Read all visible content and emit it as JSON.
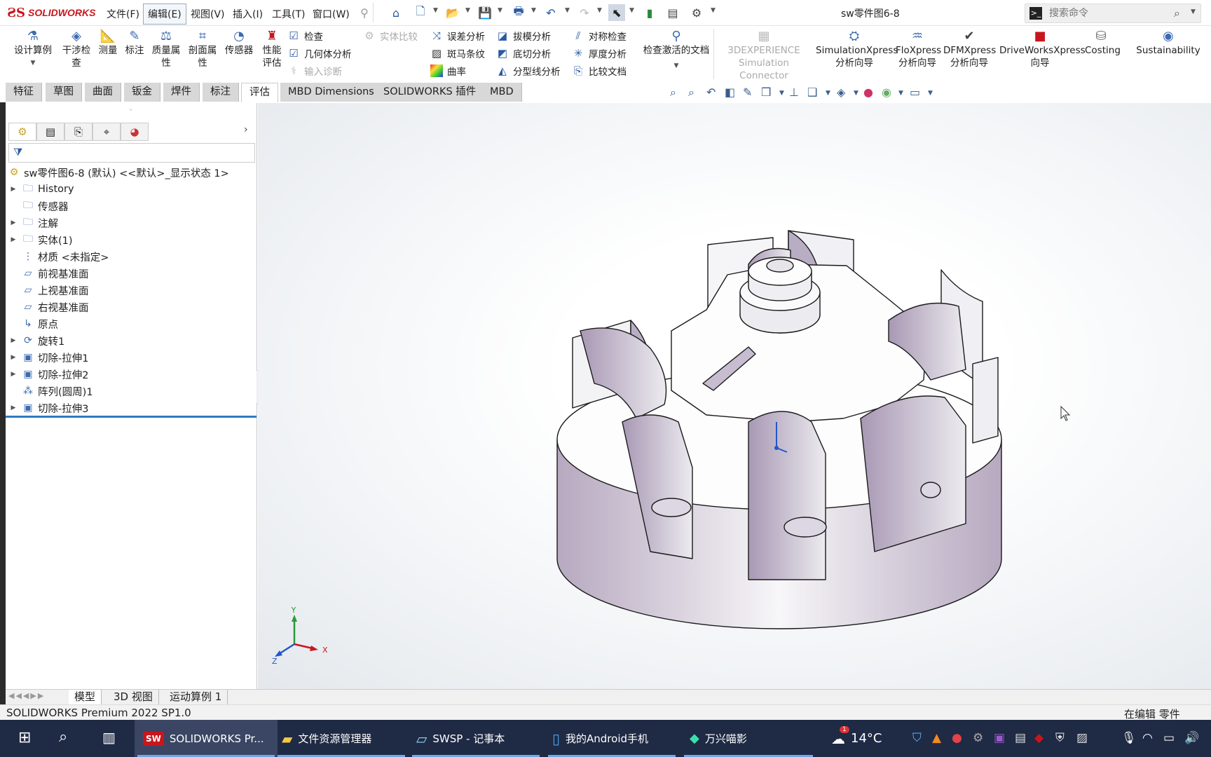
{
  "app": {
    "logo_mark": "ƧS",
    "logo_text": "SOLIDWORKS",
    "doc_title": "sw零件图6-8"
  },
  "menus": [
    "文件(F)",
    "编辑(E)",
    "视图(V)",
    "插入(I)",
    "工具(T)",
    "窗口(W)"
  ],
  "search": {
    "placeholder": "搜索命令"
  },
  "ribbon": {
    "big": [
      {
        "label1": "设计算例",
        "label2": "",
        "icon": "design-study-icon"
      },
      {
        "label1": "干涉检",
        "label2": "查",
        "icon": "interference-icon"
      },
      {
        "label1": "测量",
        "label2": "",
        "icon": "measure-icon"
      },
      {
        "label1": "标注",
        "label2": "",
        "icon": "markup-icon"
      },
      {
        "label1": "质量属",
        "label2": "性",
        "icon": "mass-props-icon"
      },
      {
        "label1": "剖面属",
        "label2": "性",
        "icon": "section-props-icon"
      },
      {
        "label1": "传感器",
        "label2": "",
        "icon": "sensor-icon"
      },
      {
        "label1": "性能",
        "label2": "评估",
        "icon": "performance-icon"
      }
    ],
    "small_col1": [
      "检查",
      "几何体分析",
      "输入诊断"
    ],
    "small_col1b": [
      "实体比较"
    ],
    "small_col2": [
      "误差分析",
      "斑马条纹",
      "曲率"
    ],
    "small_col3": [
      "拔模分析",
      "底切分析",
      "分型线分析"
    ],
    "small_col4": [
      "对称检查",
      "厚度分析",
      "比较文档"
    ],
    "check_active": "检查激活的文档",
    "connector1": "3DEXPERIENCE",
    "connector2": "Simulation Connector",
    "xpress": [
      {
        "l1": "SimulationXpress",
        "l2": "分析向导"
      },
      {
        "l1": "FloXpress",
        "l2": "分析向导"
      },
      {
        "l1": "DFMXpress",
        "l2": "分析向导"
      },
      {
        "l1": "DriveWorksXpress",
        "l2": "向导"
      },
      {
        "l1": "Costing",
        "l2": ""
      },
      {
        "l1": "Sustainability",
        "l2": ""
      }
    ]
  },
  "tabs": [
    "特征",
    "草图",
    "曲面",
    "钣金",
    "焊件",
    "标注",
    "评估",
    "MBD Dimensions",
    "SOLIDWORKS 插件",
    "MBD"
  ],
  "active_tab": "评估",
  "tree": {
    "root": "sw零件图6-8 (默认) <<默认>_显示状态 1>",
    "items": [
      {
        "label": "History",
        "expandable": true,
        "icon": "history-folder-icon"
      },
      {
        "label": "传感器",
        "expandable": false,
        "icon": "sensors-folder-icon"
      },
      {
        "label": "注解",
        "expandable": true,
        "icon": "annotations-folder-icon"
      },
      {
        "label": "实体(1)",
        "expandable": true,
        "icon": "solid-bodies-folder-icon"
      },
      {
        "label": "材质 <未指定>",
        "expandable": false,
        "icon": "material-icon"
      },
      {
        "label": "前视基准面",
        "expandable": false,
        "icon": "plane-icon"
      },
      {
        "label": "上视基准面",
        "expandable": false,
        "icon": "plane-icon"
      },
      {
        "label": "右视基准面",
        "expandable": false,
        "icon": "plane-icon"
      },
      {
        "label": "原点",
        "expandable": false,
        "icon": "origin-icon"
      },
      {
        "label": "旋转1",
        "expandable": true,
        "icon": "revolve-icon"
      },
      {
        "label": "切除-拉伸1",
        "expandable": true,
        "icon": "cut-extrude-icon"
      },
      {
        "label": "切除-拉伸2",
        "expandable": true,
        "icon": "cut-extrude-icon"
      },
      {
        "label": "阵列(圆周)1",
        "expandable": false,
        "icon": "circular-pattern-icon"
      },
      {
        "label": "切除-拉伸3",
        "expandable": true,
        "icon": "cut-extrude-icon"
      }
    ]
  },
  "bottom_tabs": [
    "模型",
    "3D 视图",
    "运动算例 1"
  ],
  "status": {
    "left": "SOLIDWORKS Premium 2022 SP1.0",
    "right": "在编辑 零件"
  },
  "triad": {
    "x": "X",
    "y": "Y",
    "z": "Z"
  },
  "taskbar": {
    "items": [
      {
        "label": "SOLIDWORKS Pr...",
        "icon": "solidworks-app-icon",
        "active": true
      },
      {
        "label": "文件资源管理器",
        "icon": "file-explorer-icon",
        "active": false
      },
      {
        "label": "SWSP - 记事本",
        "icon": "notepad-icon",
        "active": false
      },
      {
        "label": "我的Android手机",
        "icon": "phone-link-icon",
        "active": false
      },
      {
        "label": "万兴喵影",
        "icon": "filmora-icon",
        "active": false
      }
    ],
    "weather_temp": "14°C",
    "weather_badge": "1"
  },
  "colors": {
    "brand": "#c8161d",
    "accent": "#2d7cc1",
    "taskbar": "#1f2a44",
    "part_shade": "#b7a9c0"
  }
}
